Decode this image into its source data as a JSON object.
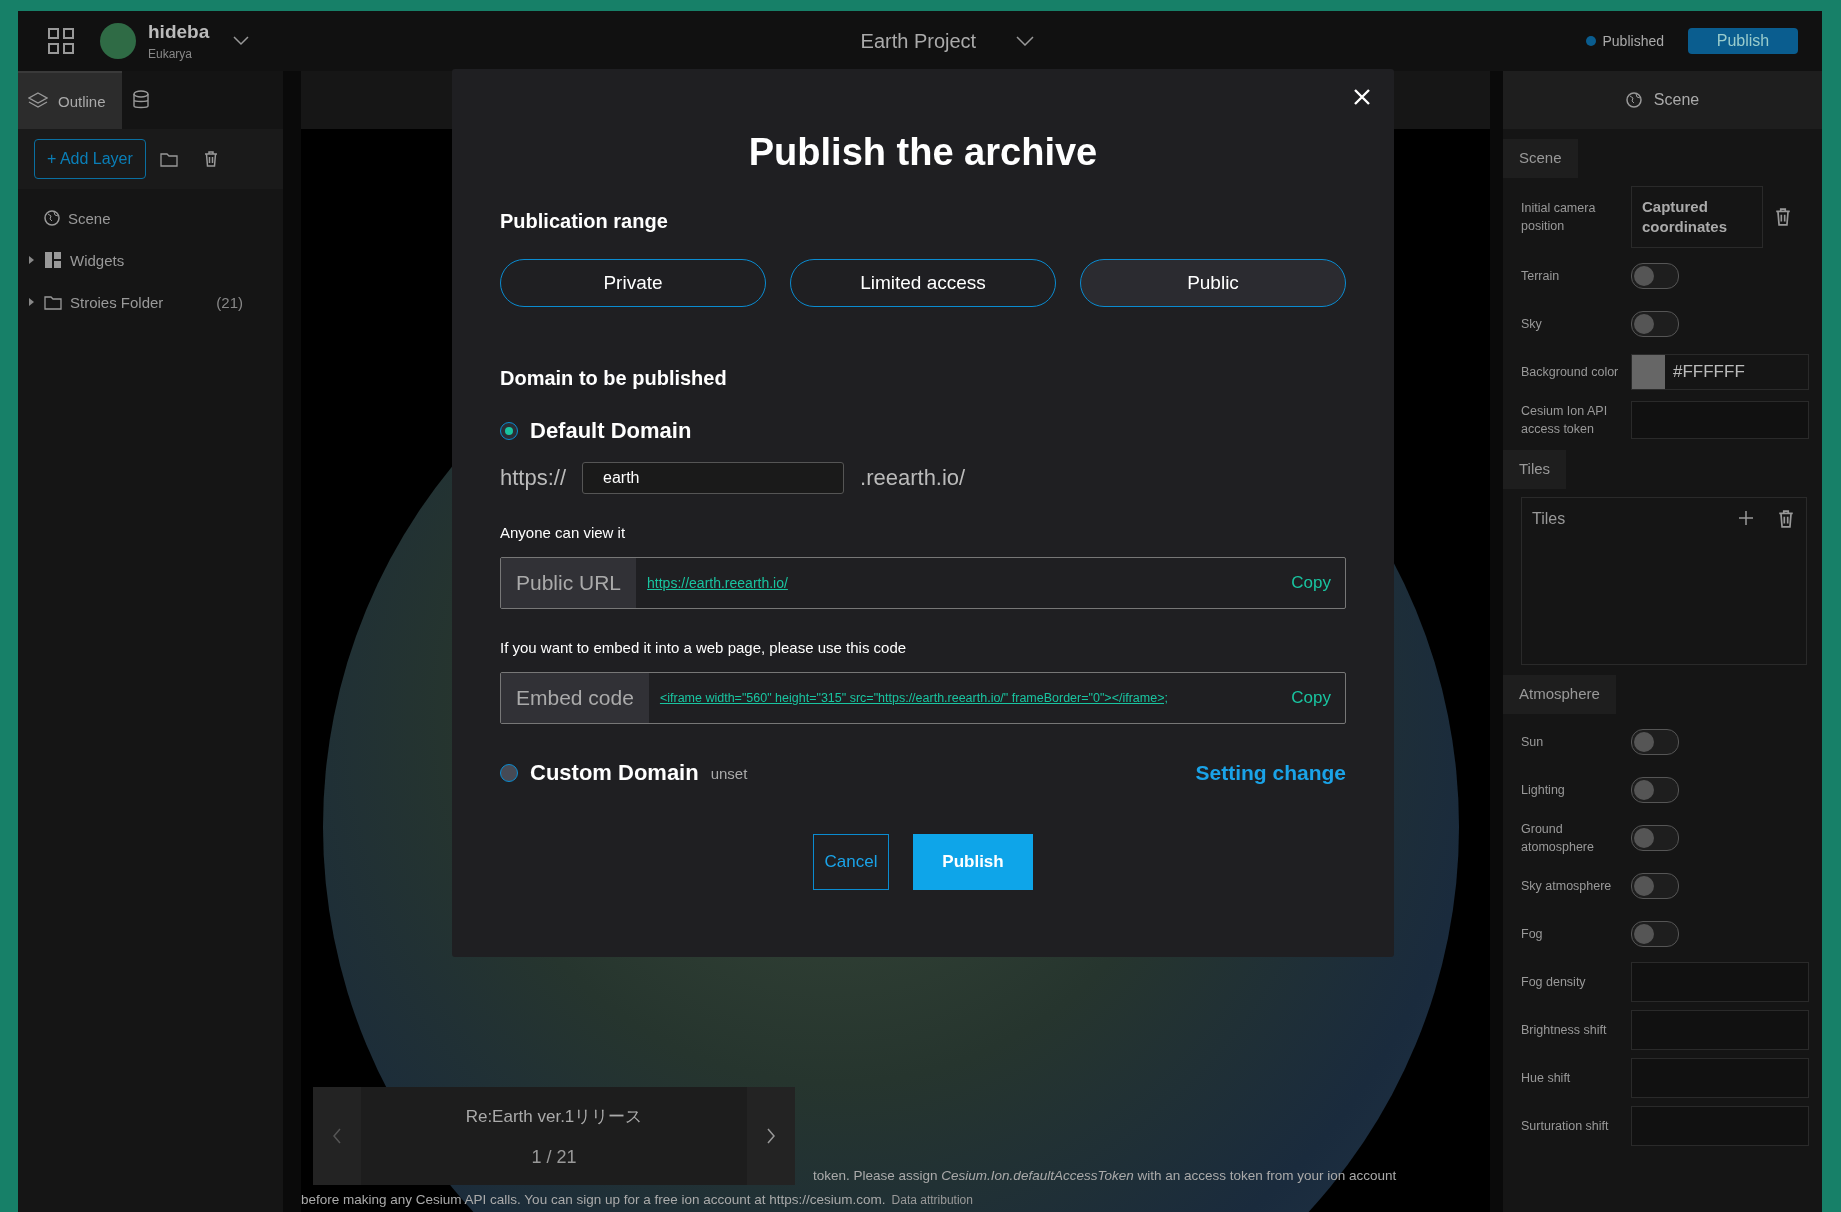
{
  "header": {
    "user": {
      "name": "hideba",
      "team": "Eukarya"
    },
    "project_title": "Earth Project",
    "status": {
      "label": "Published",
      "color": "#0a5d8f"
    },
    "publish_button": "Publish"
  },
  "left_panel": {
    "tabs": [
      {
        "kind": "outline",
        "label": "Outline",
        "selected": true
      },
      {
        "kind": "data",
        "selected": false
      }
    ],
    "add_layer_button": "+ Add Layer",
    "layers": [
      {
        "kind": "scene",
        "label": "Scene"
      },
      {
        "kind": "widgets",
        "label": "Widgets",
        "expanded": false
      },
      {
        "kind": "folder",
        "label": "Stroies Folder",
        "count": "(21)",
        "expanded": false
      }
    ]
  },
  "viewport": {
    "story": {
      "title": "Re:Earth ver.1リリース",
      "page": "1 / 21"
    },
    "attribution": [
      "token. Please assign *Cesium.Ion.defaultAccessToken* with an access token from your ion account",
      "before making any Cesium API calls. You can sign up for a free ion account at https://cesium.com."
    ],
    "attribution_link": "Data attribution"
  },
  "right_panel": {
    "title": "Scene",
    "sections": [
      {
        "heading": "Scene",
        "fields": [
          {
            "kind": "capture",
            "label": "Initial camera position",
            "value": "Captured coordinates"
          },
          {
            "kind": "toggle",
            "label": "Terrain",
            "on": false
          },
          {
            "kind": "toggle",
            "label": "Sky",
            "on": false
          },
          {
            "kind": "color",
            "label": "Background color",
            "value": "#FFFFFF"
          },
          {
            "kind": "token",
            "label": "Cesium Ion API access token"
          }
        ]
      },
      {
        "heading": "Tiles",
        "fields": [
          {
            "kind": "list",
            "title": "Tiles"
          }
        ]
      },
      {
        "heading": "Atmosphere",
        "fields": [
          {
            "kind": "toggle",
            "label": "Sun",
            "on": false
          },
          {
            "kind": "toggle",
            "label": "Lighting",
            "on": false
          },
          {
            "kind": "toggle",
            "label": "Ground atomosphere",
            "on": false
          },
          {
            "kind": "toggle",
            "label": "Sky atmosphere",
            "on": false
          },
          {
            "kind": "toggle",
            "label": "Fog",
            "on": false
          },
          {
            "kind": "text",
            "label": "Fog density"
          },
          {
            "kind": "text",
            "label": "Brightness shift"
          },
          {
            "kind": "text",
            "label": "Hue shift"
          },
          {
            "kind": "text",
            "label": "Surturation shift"
          }
        ]
      }
    ]
  },
  "modal": {
    "title": "Publish the archive",
    "range_heading": "Publication range",
    "ranges": [
      {
        "label": "Private",
        "selected": false
      },
      {
        "label": "Limited access",
        "selected": false
      },
      {
        "label": "Public",
        "selected": true
      }
    ],
    "domain_heading": "Domain to be published",
    "default_domain": {
      "label": "Default Domain",
      "selected": true,
      "prefix": "https://",
      "value": "earth",
      "suffix": ".reearth.io/"
    },
    "public_note": "Anyone can view it",
    "public_url": {
      "label": "Public URL",
      "value": "https://earth.reearth.io/",
      "copy": "Copy"
    },
    "embed_note": "If you want to embed it into a web page, please use this code",
    "embed_code": {
      "label": "Embed code",
      "value": "<iframe width=\"560\" height=\"315\" src=\"https://earth.reearth.io/\" frameBorder=\"0\"></iframe>;",
      "copy": "Copy"
    },
    "custom_domain": {
      "label": "Custom Domain",
      "selected": false,
      "note": "unset",
      "action": "Setting change"
    },
    "buttons": [
      {
        "kind": "secondary",
        "label": "Cancel"
      },
      {
        "kind": "primary",
        "label": "Publish"
      }
    ]
  }
}
